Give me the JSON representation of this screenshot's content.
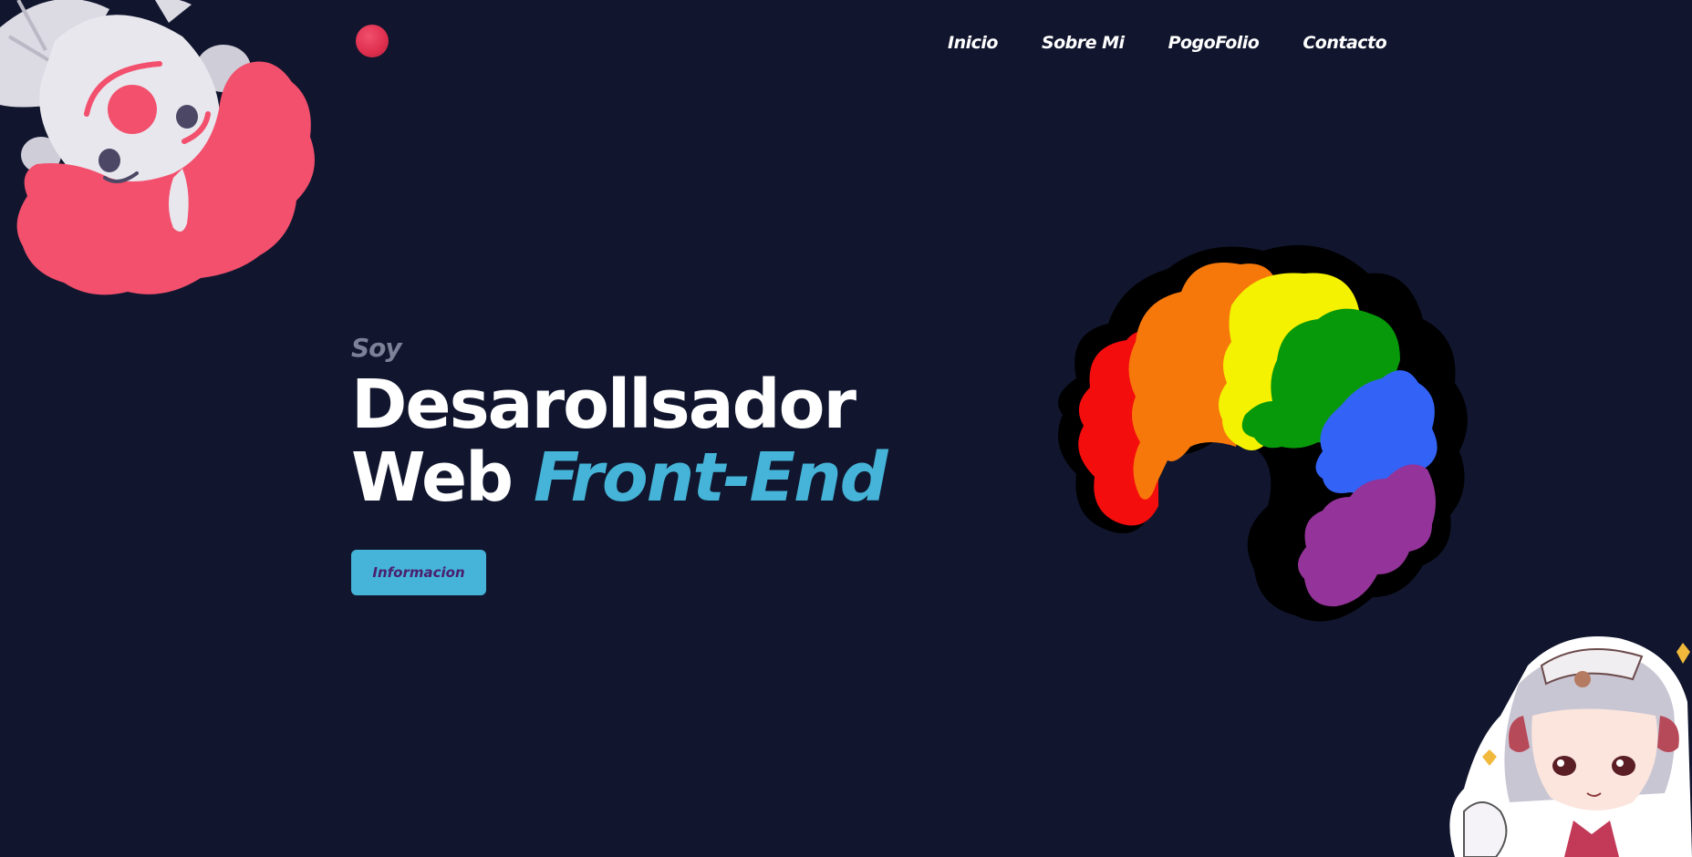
{
  "nav": {
    "items": [
      {
        "label": "Inicio"
      },
      {
        "label": "Sobre Mi"
      },
      {
        "label": "PogoFolio"
      },
      {
        "label": "Contacto"
      }
    ]
  },
  "hero": {
    "eyebrow": "Soy",
    "title_line1": "Desarollsador",
    "title_line2_plain": "Web",
    "title_line2_accent": "Front-End",
    "button_label": "Informacion"
  },
  "colors": {
    "background": "#11162e",
    "accent": "#45b4d8",
    "brand_dot": "#e0304f",
    "button_text": "#4a1f6e"
  },
  "icons": {
    "logo": "red-dot-icon",
    "top_left_art": "ghost-character-illustration",
    "right_art": "rainbow-afro-wig-illustration",
    "bottom_right_art": "anime-maid-girl-illustration"
  }
}
